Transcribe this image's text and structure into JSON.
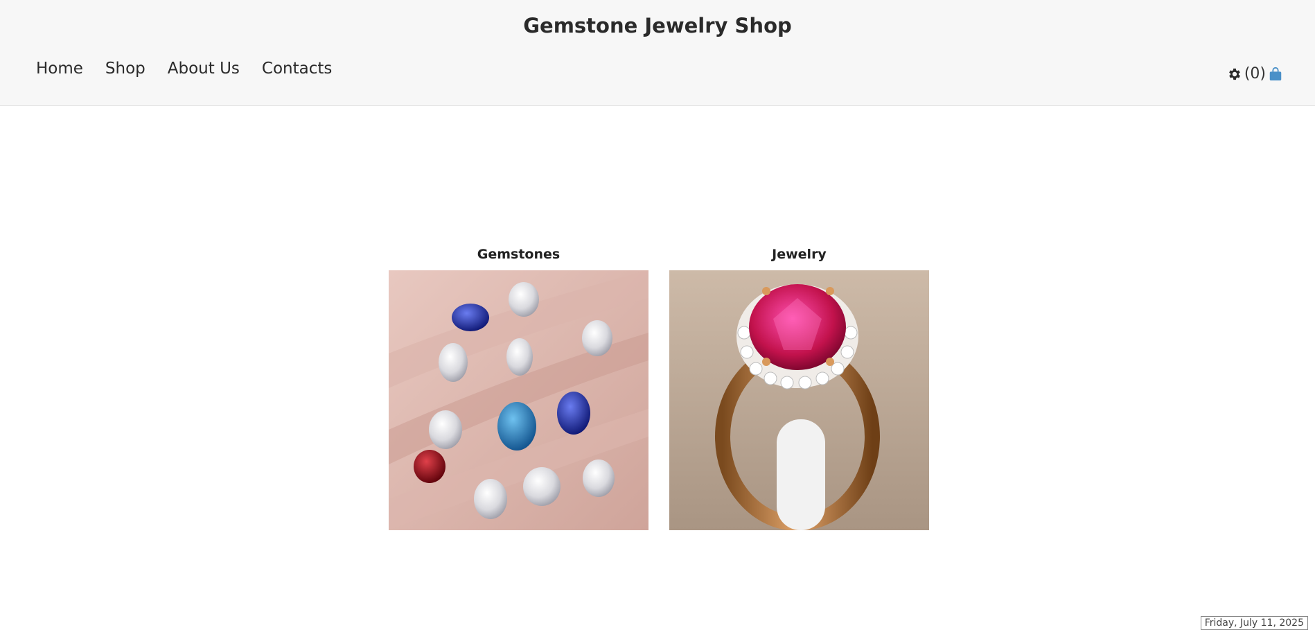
{
  "header": {
    "title": "Gemstone Jewelry Shop",
    "nav": [
      "Home",
      "Shop",
      "About Us",
      "Contacts"
    ],
    "cart_count": "(0)",
    "icons": {
      "settings": "gear-icon",
      "cart": "shopping-bag-icon"
    },
    "colors": {
      "cart_icon": "#4a90c8",
      "header_bg": "#f7f7f7"
    }
  },
  "categories": [
    {
      "title": "Gemstones",
      "image": "loose-gemstones-photo"
    },
    {
      "title": "Jewelry",
      "image": "ruby-gold-ring-photo"
    }
  ],
  "footer": {
    "date": "Friday, July 11, 2025"
  }
}
